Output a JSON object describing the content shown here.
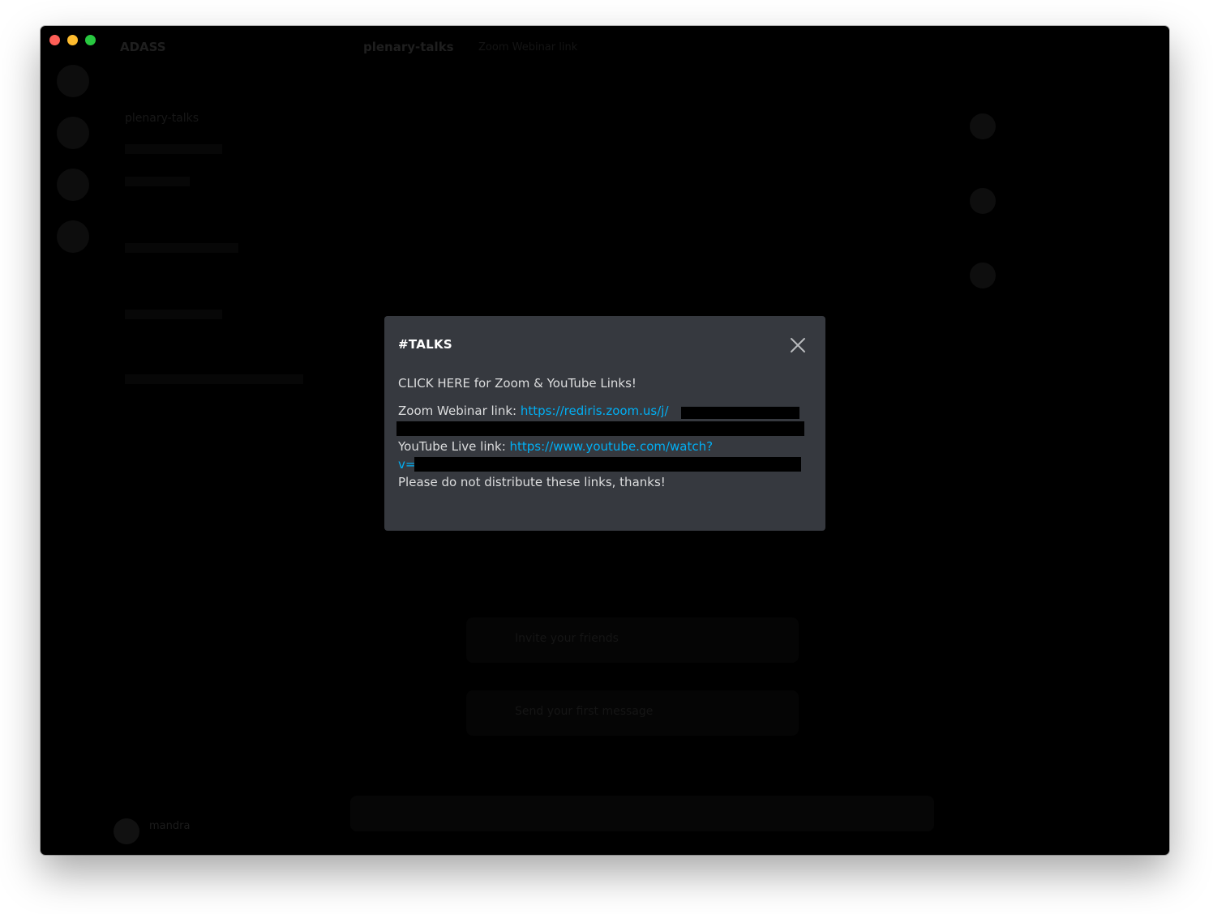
{
  "app": {
    "server_name": "ADASS",
    "header_channel": "plenary-talks",
    "header_topic": "Zoom Webinar link"
  },
  "modal": {
    "title": "#TALKS",
    "line1": "CLICK HERE for Zoom & YouTube Links!",
    "zoom_label": "Zoom Webinar link: ",
    "zoom_url": "https://rediris.zoom.us/j/",
    "youtube_label": "YouTube Live link: ",
    "youtube_url_part1": "https://www.youtube.com/watch?",
    "youtube_url_part2": "v=",
    "footer": "Please do not distribute these links, thanks!"
  },
  "background": {
    "channels": [
      "plenary-talks"
    ],
    "cards": [
      "Invite your friends",
      "Send your first message"
    ],
    "user_name": "mandra"
  },
  "icons": {
    "close": "close-icon"
  },
  "colors": {
    "modal_bg": "#36393f",
    "link": "#00aff4",
    "title": "#ffffff"
  }
}
